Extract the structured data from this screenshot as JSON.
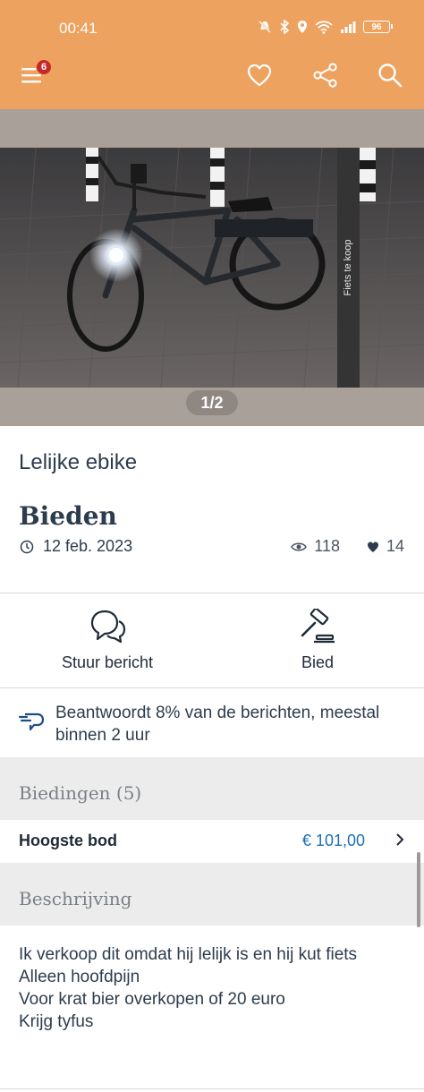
{
  "status_bar": {
    "time": "00:41",
    "battery": "96"
  },
  "app_bar": {
    "notification_count": "6"
  },
  "listing": {
    "photo_caption": "Fiets te koop",
    "pager": "1/2",
    "title": "Lelijke ebike",
    "price_label": "Bieden",
    "date": "12 feb. 2023",
    "views": "118",
    "favorites": "14"
  },
  "actions": {
    "message_label": "Stuur bericht",
    "bid_label": "Bied"
  },
  "reply_info": "Beantwoordt 8% van de berichten, meestal binnen 2 uur",
  "bids": {
    "header": "Biedingen (5)",
    "highest_label": "Hoogste bod",
    "highest_value": "€ 101,00"
  },
  "description": {
    "header": "Beschrijving",
    "lines": [
      "Ik verkoop dit omdat hij lelijk is en hij kut fiets",
      "Alleen hoofdpijn",
      "Voor krat bier overkopen of 20 euro",
      "Krijg tyfus"
    ]
  },
  "colors": {
    "brand_orange": "#eda25f",
    "price_blue": "#1c6fb5",
    "text_dark": "#2d3c4d"
  }
}
